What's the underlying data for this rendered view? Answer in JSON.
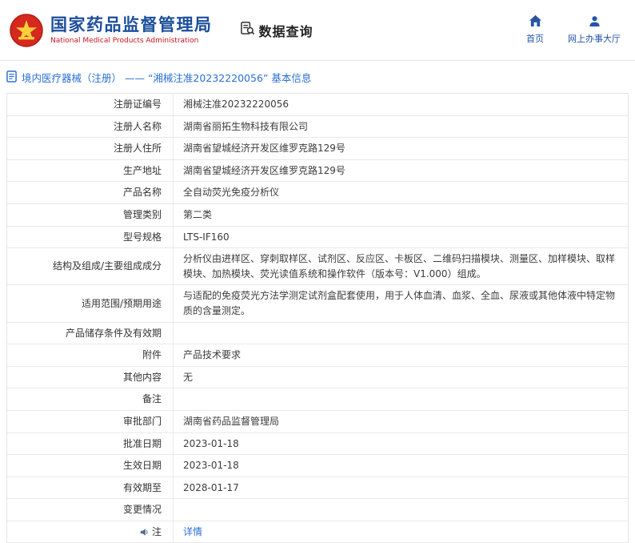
{
  "header": {
    "agency_cn": "国家药品监督管理局",
    "agency_en": "National Medical Products Administration",
    "section_title": "数据查询",
    "nav_home": "首页",
    "nav_hall": "网上办事大厅"
  },
  "page": {
    "breadcrumb": "境内医疗器械（注册） —— “湘械注准20232220056” 基本信息"
  },
  "table": {
    "rows": [
      {
        "label": "注册证编号",
        "value": "湘械注准20232220056"
      },
      {
        "label": "注册人名称",
        "value": "湖南省丽拓生物科技有限公司"
      },
      {
        "label": "注册人住所",
        "value": "湖南省望城经济开发区维罗克路129号"
      },
      {
        "label": "生产地址",
        "value": "湖南省望城经济开发区维罗克路129号"
      },
      {
        "label": "产品名称",
        "value": "全自动荧光免疫分析仪"
      },
      {
        "label": "管理类别",
        "value": "第二类"
      },
      {
        "label": "型号规格",
        "value": "LTS-IF160"
      },
      {
        "label": "结构及组成/主要组成成分",
        "value": "分析仪由进样区、穿刺取样区、试剂区、反应区、卡板区、二维码扫描模块、测量区、加样模块、取样模块、加热模块、荧光读值系统和操作软件（版本号：V1.000）组成。"
      },
      {
        "label": "适用范围/预期用途",
        "value": "与适配的免疫荧光方法学测定试剂盒配套使用，用于人体血清、血浆、全血、尿液或其他体液中特定物质的含量测定。"
      },
      {
        "label": "产品储存条件及有效期",
        "value": ""
      },
      {
        "label": "附件",
        "value": "产品技术要求"
      },
      {
        "label": "其他内容",
        "value": "无"
      },
      {
        "label": "备注",
        "value": ""
      },
      {
        "label": "审批部门",
        "value": "湖南省药品监督管理局"
      },
      {
        "label": "批准日期",
        "value": "2023-01-18"
      },
      {
        "label": "生效日期",
        "value": "2023-01-18"
      },
      {
        "label": "有效期至",
        "value": "2028-01-17"
      },
      {
        "label": "变更情况",
        "value": ""
      },
      {
        "label": "注",
        "value": "详情"
      }
    ]
  },
  "colors": {
    "brand_blue": "#1b4e9b",
    "brand_red": "#c8161d",
    "link_blue": "#2a6fd3",
    "emblem_red": "#d5281e",
    "emblem_gold": "#f7d03c"
  }
}
